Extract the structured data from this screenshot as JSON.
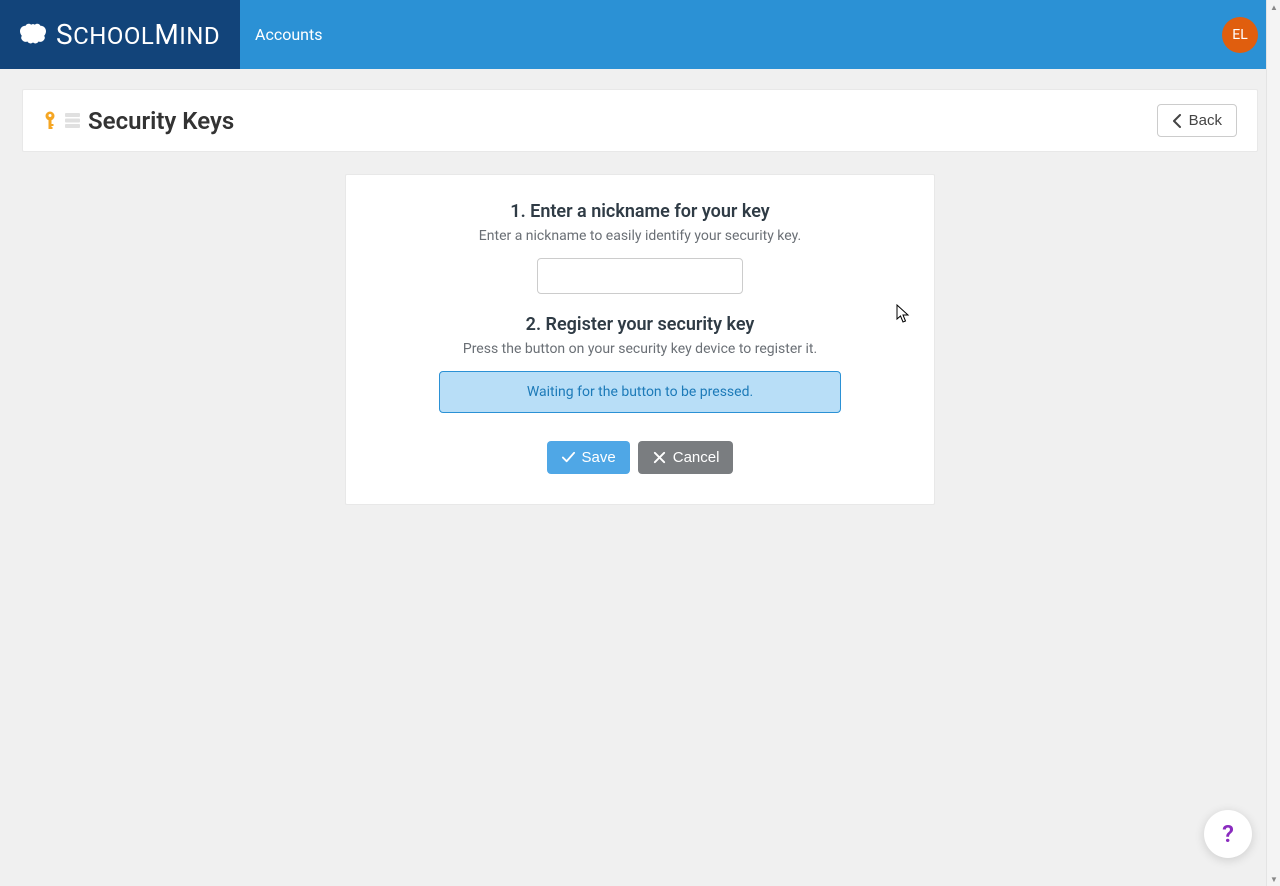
{
  "header": {
    "brand": "SchoolMind",
    "nav_item": "Accounts",
    "avatar_initials": "EL"
  },
  "page": {
    "title": "Security Keys",
    "back_label": "Back"
  },
  "form": {
    "step1_heading": "1. Enter a nickname for your key",
    "step1_desc": "Enter a nickname to easily identify your security key.",
    "nickname_value": "",
    "step2_heading": "2. Register your security key",
    "step2_desc": "Press the button on your security key device to register it.",
    "status_message": "Waiting for the button to be pressed.",
    "save_label": "Save",
    "cancel_label": "Cancel"
  },
  "help": {
    "label": "?"
  }
}
